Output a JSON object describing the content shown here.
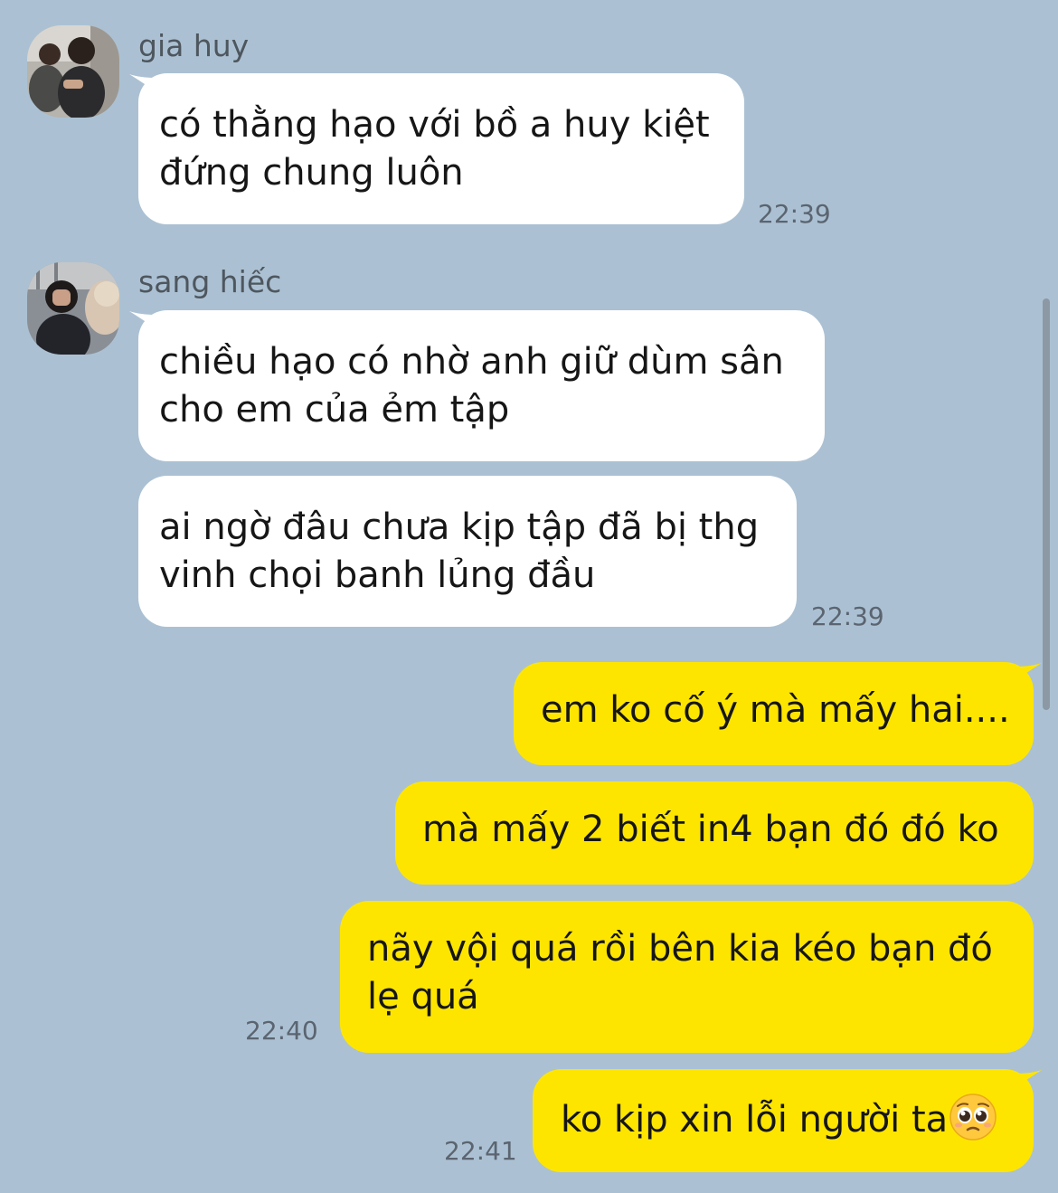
{
  "messages": [
    {
      "sender": "gia huy",
      "bubbles": [
        {
          "lines": [
            "có thằng hạo với bồ a huy kiệt",
            "đứng chung luôn"
          ]
        }
      ],
      "time": "22:39"
    },
    {
      "sender": "sang hiếc",
      "bubbles": [
        {
          "lines": [
            "chiều hạo có nhờ anh giữ dùm sân",
            "cho em của ẻm tập"
          ]
        },
        {
          "lines": [
            "ai ngờ đâu chưa kịp tập đã bị thg",
            "vinh chọi banh lủng đầu"
          ]
        }
      ],
      "time": "22:39"
    }
  ],
  "my_messages": [
    {
      "lines": [
        "em ko cố ý mà mấy hai...."
      ]
    },
    {
      "lines": [
        "mà mấy 2 biết in4 bạn đó đó ko"
      ]
    },
    {
      "lines": [
        "nãy vội quá rồi bên kia kéo bạn đó",
        "lẹ quá"
      ],
      "time": "22:40"
    },
    {
      "lines": [
        "ko kịp xin lỗi người ta"
      ],
      "emoji": "pleading-face",
      "time": "22:41"
    }
  ],
  "colors": {
    "background": "#abc1d3",
    "incoming_bubble": "#ffffff",
    "outgoing_bubble": "#fee500",
    "timestamp": "#5b6470",
    "sender_name": "#4e565e"
  },
  "icons": {
    "avatar_1": "profile-photo",
    "avatar_2": "profile-photo",
    "emoji": "pleading-face-emoji"
  }
}
